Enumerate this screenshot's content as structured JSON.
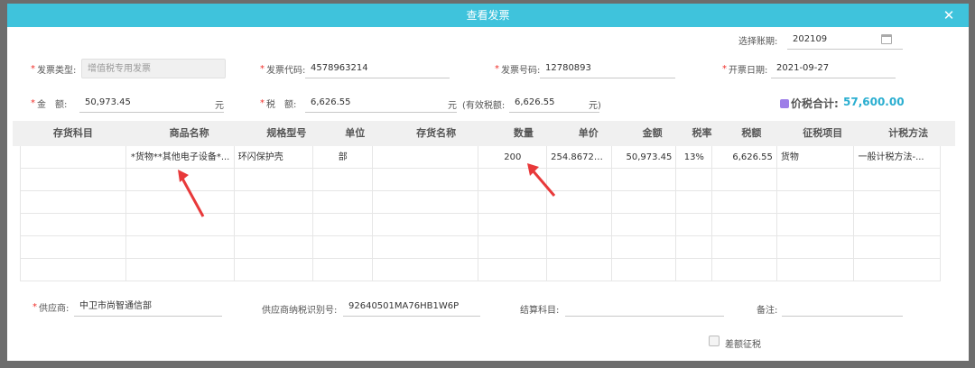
{
  "dialog": {
    "title": "查看发票",
    "close_glyph": "✕"
  },
  "header": {
    "period": {
      "label": "选择账期:",
      "value": "202109",
      "icon": "calendar-icon"
    },
    "invoice_type": {
      "label": "发票类型:",
      "value": "增值税专用发票",
      "required": "*"
    },
    "invoice_code": {
      "label": "发票代码:",
      "value": "4578963214",
      "required": "*"
    },
    "invoice_number": {
      "label": "发票号码:",
      "value": "12780893",
      "required": "*"
    },
    "issue_date": {
      "label": "开票日期:",
      "value": "2021-09-27",
      "required": "*"
    },
    "amount": {
      "label": "金　额:",
      "value": "50,973.45",
      "unit": "元",
      "required": "*"
    },
    "tax": {
      "label": "税　额:",
      "value": "6,626.55",
      "unit": "元",
      "required": "*"
    },
    "valid_tax": {
      "label": "(有效税额:",
      "value": "6,626.55",
      "unit": "元)"
    },
    "total": {
      "label": "价税合计:",
      "value": "57,600.00"
    }
  },
  "table": {
    "columns": [
      "存货科目",
      "商品名称",
      "规格型号",
      "单位",
      "存货名称",
      "数量",
      "单价",
      "金额",
      "税率",
      "税额",
      "征税项目",
      "计税方法"
    ],
    "rows": [
      [
        "",
        "*货物**其他电子设备*...",
        "环闪保护壳",
        "部",
        "",
        "200",
        "254.8672566",
        "50,973.45",
        "13%",
        "6,626.55",
        "货物",
        "一般计税方法-..."
      ],
      [
        "",
        "",
        "",
        "",
        "",
        "",
        "",
        "",
        "",
        "",
        "",
        ""
      ],
      [
        "",
        "",
        "",
        "",
        "",
        "",
        "",
        "",
        "",
        "",
        "",
        ""
      ],
      [
        "",
        "",
        "",
        "",
        "",
        "",
        "",
        "",
        "",
        "",
        "",
        ""
      ],
      [
        "",
        "",
        "",
        "",
        "",
        "",
        "",
        "",
        "",
        "",
        "",
        ""
      ],
      [
        "",
        "",
        "",
        "",
        "",
        "",
        "",
        "",
        "",
        "",
        "",
        ""
      ]
    ]
  },
  "footer": {
    "supplier": {
      "label": "供应商:",
      "value": "中卫市尚智通信部",
      "required": "*"
    },
    "supplier_tax_id": {
      "label": "供应商纳税识别号:",
      "value": "92640501MA76HB1W6P"
    },
    "settlement_account": {
      "label": "结算科目:",
      "value": ""
    },
    "remarks": {
      "label": "备注:",
      "value": ""
    },
    "diff_tax": {
      "label": "差额征税"
    }
  },
  "colors": {
    "titlebar": "#3fc3dc",
    "required": "#f0302b",
    "total_value": "#2aaed0",
    "arrow": "#e8393a"
  }
}
